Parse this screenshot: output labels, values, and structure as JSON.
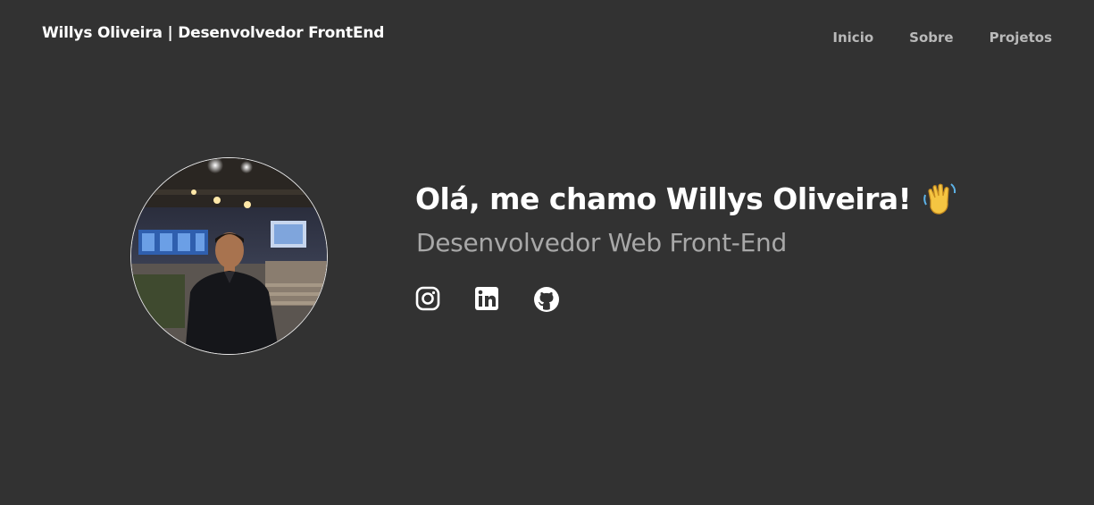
{
  "header": {
    "brand": "Willys Oliveira | Desenvolvedor FrontEnd",
    "nav": [
      {
        "label": "Inicio"
      },
      {
        "label": "Sobre"
      },
      {
        "label": "Projetos"
      }
    ]
  },
  "hero": {
    "title": "Olá, me chamo Willys Oliveira!",
    "subtitle": "Desenvolvedor Web Front-End",
    "wave_icon": "waving-hand-icon",
    "socials": [
      {
        "icon": "instagram-icon"
      },
      {
        "icon": "linkedin-icon"
      },
      {
        "icon": "github-icon"
      }
    ]
  },
  "colors": {
    "background": "#323232",
    "heading": "#ffffff",
    "nav_link": "#b9b9b9",
    "subtitle": "#a8a8a8"
  }
}
